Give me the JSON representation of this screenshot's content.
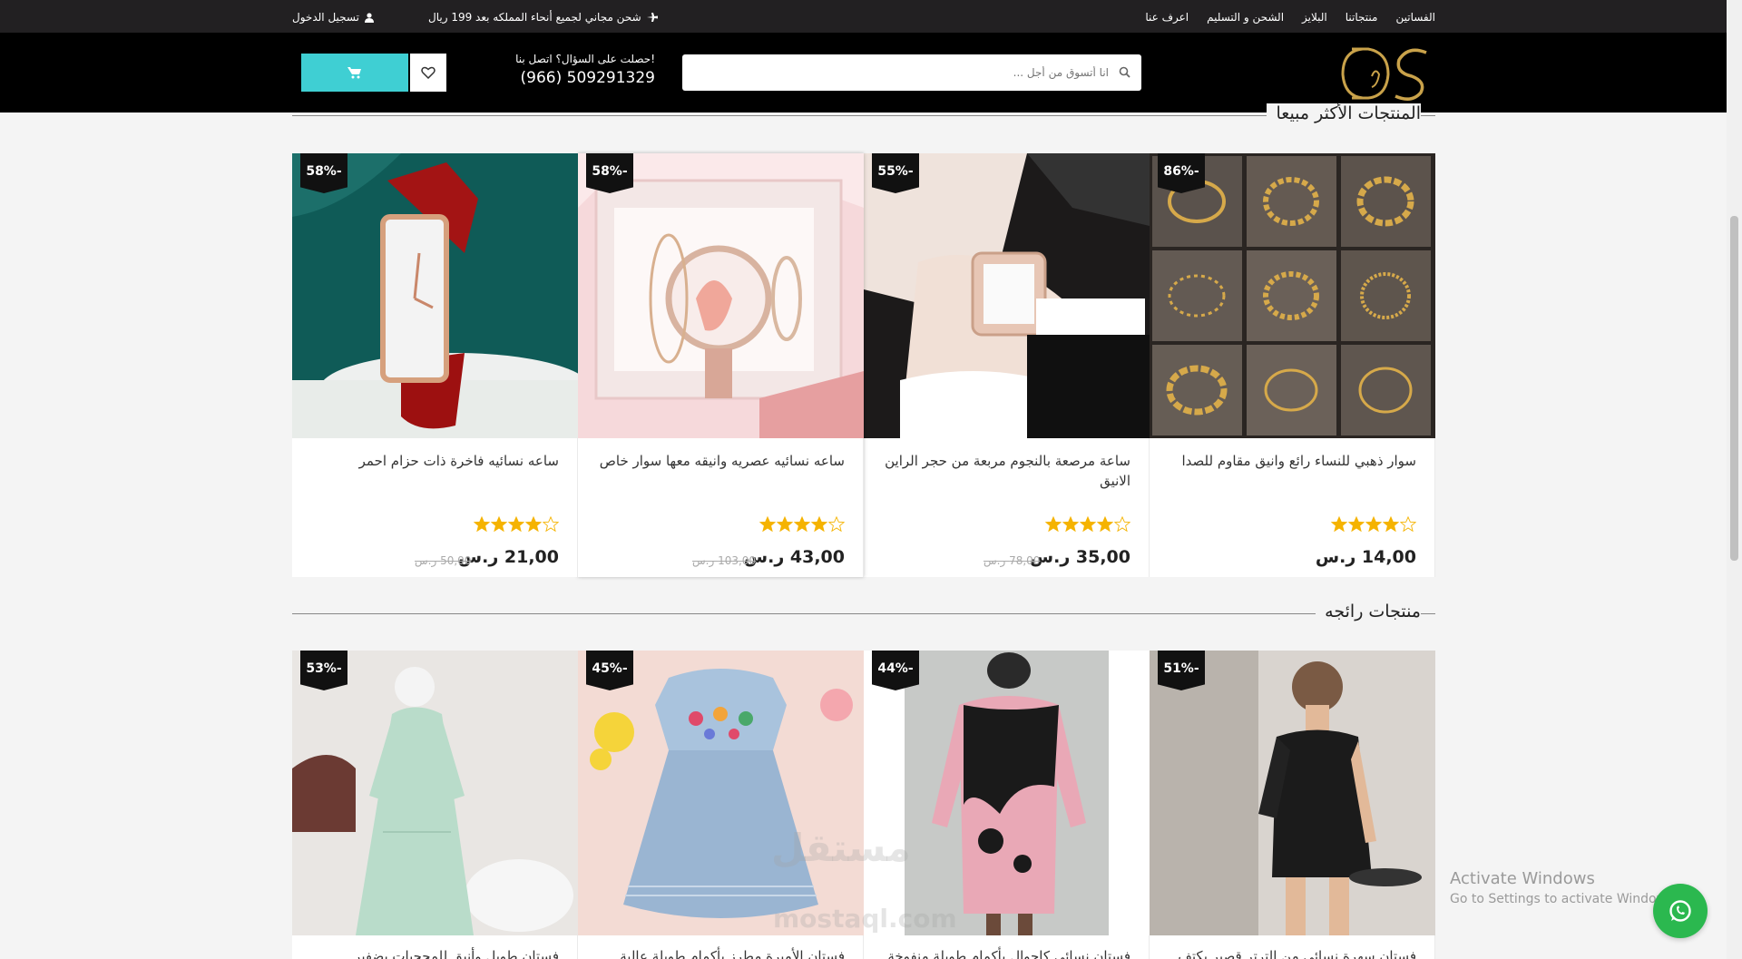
{
  "topbar": {
    "login": "تسجيل الدخول",
    "promo": "شحن مجاني لجميع أنحاء المملكه بعد 199 ريال",
    "nav": [
      "الفساتين",
      "منتجاتنا",
      "البلايز",
      "الشحن و التسليم",
      "اعرف عنا"
    ]
  },
  "header": {
    "search_placeholder": "انا أتسوق من أجل ...",
    "contact_question": "حصلت على السؤال؟ اتصل بنا!",
    "phone": "(966) 509291329",
    "logo_text": "DS"
  },
  "sections": [
    {
      "title": "المنتجات الأكثر مبيعا",
      "products": [
        {
          "name": "سوار ذهبي للنساء رائع وانيق مقاوم للصدا",
          "discount": "86%-",
          "price": "14,00 ر.س",
          "old_price": ""
        },
        {
          "name": "ساعة مرصعة بالنجوم مربعة من حجر الراين الانيق",
          "discount": "55%-",
          "price": "35,00 ر.س",
          "old_price": "78,00 ر.س"
        },
        {
          "name": "ساعه نسائيه عصريه وانيقه معها سوار خاص",
          "discount": "58%-",
          "price": "43,00 ر.س",
          "old_price": "103,00 ر.س"
        },
        {
          "name": "ساعه نسائيه فاخرة ذات حزام احمر",
          "discount": "58%-",
          "price": "21,00 ر.س",
          "old_price": "50,00 ر.س"
        }
      ]
    },
    {
      "title": "منتجات رائجه",
      "products": [
        {
          "name": "فستان سهرة نسائي من الترتر قصير بكتف",
          "discount": "51%-"
        },
        {
          "name": "فستان نسائي كاجوال بأكمام طويلة منفوخة",
          "discount": "44%-"
        },
        {
          "name": "فستان الأميرة مطرز بأكمام طويلة عالية",
          "discount": "45%-"
        },
        {
          "name": "فستان طويل وأنيق للمحجبات بضفير",
          "discount": "53%-"
        }
      ]
    }
  ],
  "watermark": {
    "line1": "مستقل",
    "line2": "mostaql.com"
  },
  "activate_windows": {
    "title": "Activate Windows",
    "subtitle": "Go to Settings to activate Windows."
  },
  "colors": {
    "accent": "#3fcfd3",
    "topbar": "#222022",
    "header": "#000000",
    "whatsapp": "#2bb84f",
    "star": "#f5b301"
  }
}
